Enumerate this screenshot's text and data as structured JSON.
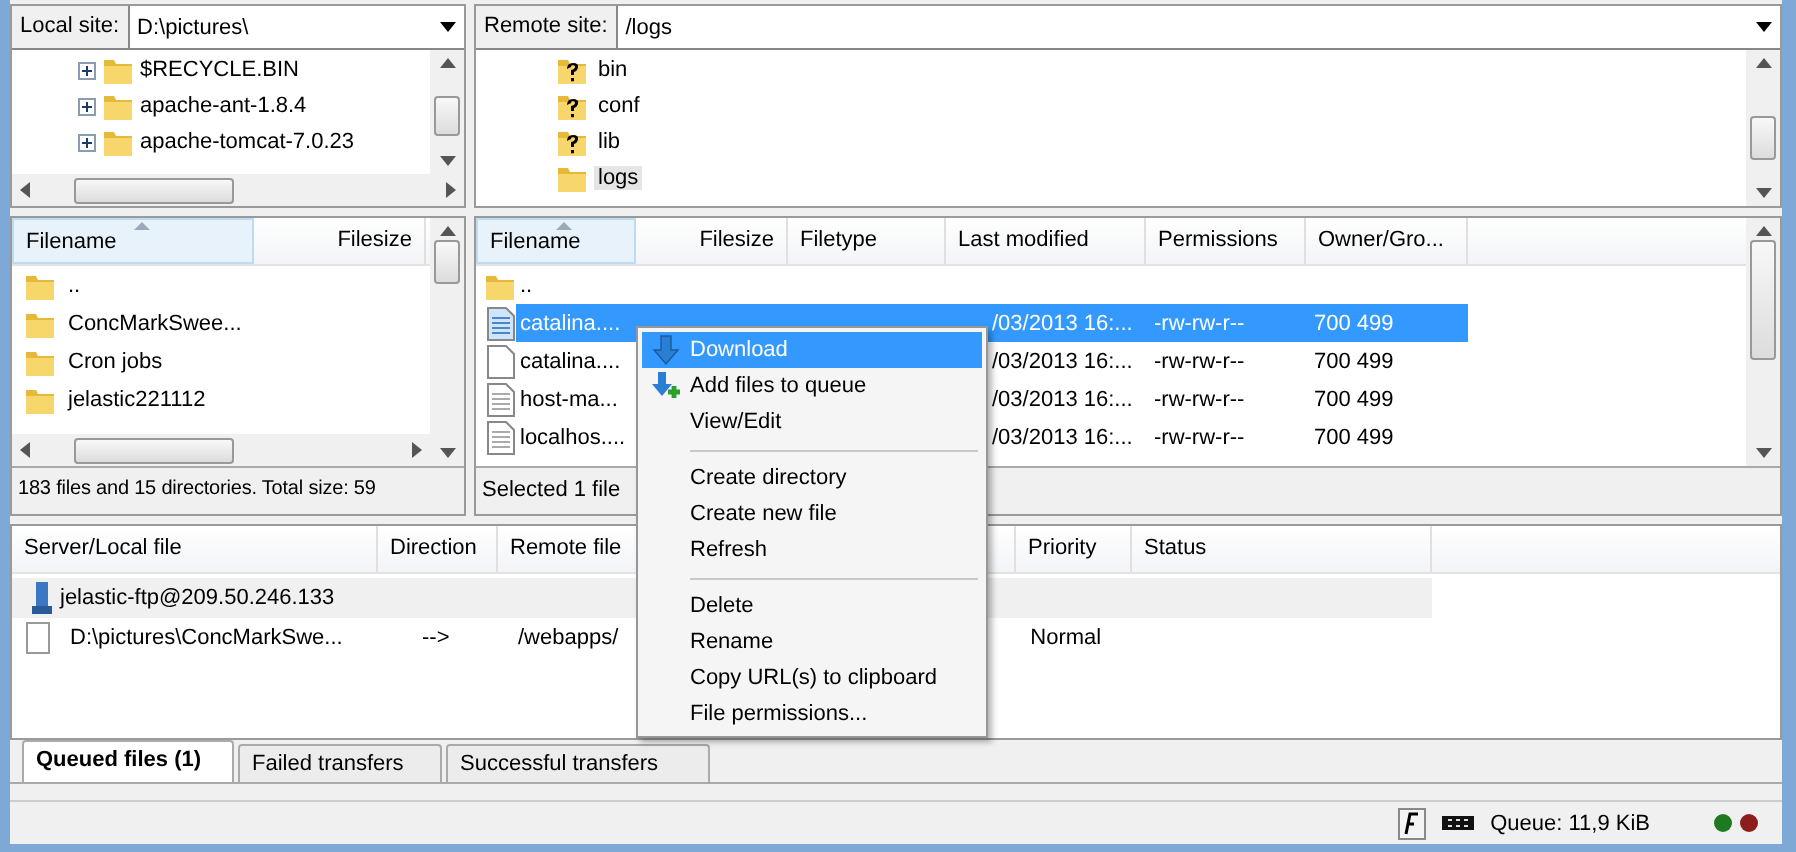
{
  "local_site": {
    "label": "Local site:",
    "path": "D:\\pictures\\"
  },
  "remote_site": {
    "label": "Remote site:",
    "path": "/logs"
  },
  "local_tree": [
    {
      "name": "$RECYCLE.BIN",
      "expanded": false
    },
    {
      "name": "apache-ant-1.8.4",
      "expanded": false
    },
    {
      "name": "apache-tomcat-7.0.23",
      "expanded": false
    }
  ],
  "remote_tree": [
    {
      "name": "bin",
      "kind": "unknown",
      "selected": false
    },
    {
      "name": "conf",
      "kind": "unknown",
      "selected": false
    },
    {
      "name": "lib",
      "kind": "unknown",
      "selected": false
    },
    {
      "name": "logs",
      "kind": "folder",
      "selected": true
    }
  ],
  "local_list": {
    "columns": [
      "Filename",
      "Filesize"
    ],
    "rows": [
      {
        "name": "..",
        "kind": "folder"
      },
      {
        "name": "ConcMarkSwee...",
        "kind": "folder"
      },
      {
        "name": "Cron jobs",
        "kind": "folder"
      },
      {
        "name": "jelastic221112",
        "kind": "folder"
      }
    ],
    "status": "183 files and 15 directories. Total size: 59"
  },
  "remote_list": {
    "columns": [
      "Filename",
      "Filesize",
      "Filetype",
      "Last modified",
      "Permissions",
      "Owner/Gro..."
    ],
    "rows": [
      {
        "kind": "folder",
        "selected": false,
        "filename": ".."
      },
      {
        "kind": "text",
        "selected": true,
        "filename": "catalina....",
        "last_modified": "/03/2013 16:...",
        "permissions": "-rw-rw-r--",
        "owner": "700 499"
      },
      {
        "kind": "file",
        "selected": false,
        "filename": "catalina....",
        "last_modified": "/03/2013 16:...",
        "permissions": "-rw-rw-r--",
        "owner": "700 499"
      },
      {
        "kind": "text",
        "selected": false,
        "filename": "host-ma...",
        "last_modified": "/03/2013 16:...",
        "permissions": "-rw-rw-r--",
        "owner": "700 499"
      },
      {
        "kind": "text",
        "selected": false,
        "filename": "localhos....",
        "last_modified": "/03/2013 16:...",
        "permissions": "-rw-rw-r--",
        "owner": "700 499"
      }
    ],
    "status": "Selected 1 file"
  },
  "queue": {
    "columns": [
      "Server/Local file",
      "Direction",
      "Remote file",
      "Priority",
      "Status"
    ],
    "rows": [
      {
        "kind": "server",
        "text": "jelastic-ftp@209.50.246.133"
      },
      {
        "kind": "file",
        "local": "D:\\pictures\\ConcMarkSwe...",
        "direction": "-->",
        "remote": "/webapps/",
        "priority": "Normal"
      }
    ]
  },
  "tabs": [
    {
      "label": "Queued files (1)",
      "selected": true
    },
    {
      "label": "Failed transfers",
      "selected": false
    },
    {
      "label": "Successful transfers",
      "selected": false
    }
  ],
  "context_menu": [
    {
      "kind": "item",
      "label": "Download",
      "selected": true
    },
    {
      "kind": "item",
      "label": "Add files to queue",
      "selected": false
    },
    {
      "kind": "item",
      "label": "View/Edit",
      "selected": false
    },
    {
      "kind": "separator"
    },
    {
      "kind": "item",
      "label": "Create directory",
      "selected": false
    },
    {
      "kind": "item",
      "label": "Create new file",
      "selected": false
    },
    {
      "kind": "item",
      "label": "Refresh",
      "selected": false
    },
    {
      "kind": "separator"
    },
    {
      "kind": "item",
      "label": "Delete",
      "selected": false
    },
    {
      "kind": "item",
      "label": "Rename",
      "selected": false
    },
    {
      "kind": "item",
      "label": "Copy URL(s) to clipboard",
      "selected": false
    },
    {
      "kind": "item",
      "label": "File permissions...",
      "selected": false
    }
  ],
  "status_bar": {
    "queue": "Queue: 11,9 KiB",
    "lights": [
      {
        "color": "#1f7a1f"
      },
      {
        "color": "#8c1d1d"
      }
    ]
  }
}
